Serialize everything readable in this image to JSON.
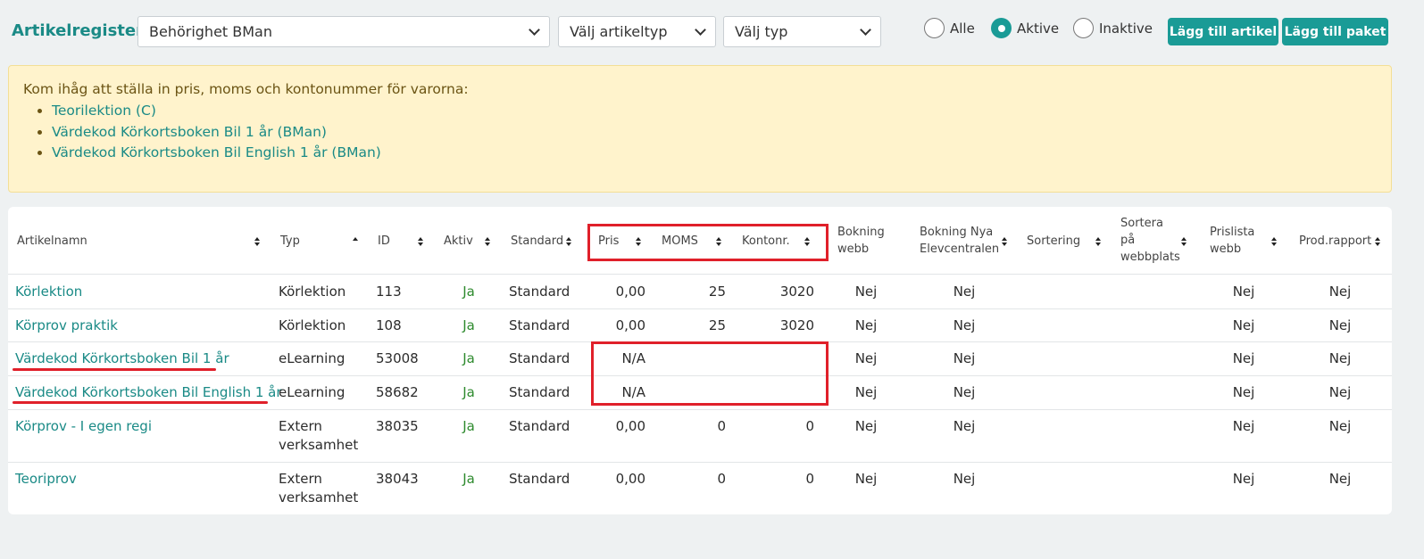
{
  "header": {
    "title": "Artikelregister",
    "behorighet": "Behörighet BMan",
    "artikeltyp": "Välj artikeltyp",
    "typ": "Välj typ",
    "radio_all": "Alle",
    "radio_active": "Aktive",
    "radio_inactive": "Inaktive",
    "btn_add_article": "Lägg till artikel",
    "btn_add_package": "Lägg till paket"
  },
  "alert": {
    "text": "Kom ihåg att ställa in pris, moms och kontonummer för varorna:",
    "items": [
      "Teorilektion (C)",
      "Värdekod Körkortsboken Bil 1 år (BMan)",
      "Värdekod Körkortsboken Bil English 1 år (BMan)"
    ]
  },
  "table": {
    "columns": {
      "artikelnamn": "Artikelnamn",
      "typ": "Typ",
      "id": "ID",
      "aktiv": "Aktiv",
      "standard": "Standard",
      "pris": "Pris",
      "moms": "MOMS",
      "kontonr": "Kontonr.",
      "bokning_webb_1": "Bokning",
      "bokning_webb_2": "webb",
      "bokning_nya_1": "Bokning Nya",
      "bokning_nya_2": "Elevcentralen",
      "sortering": "Sortering",
      "sortera_1": "Sortera",
      "sortera_2": "på",
      "sortera_3": "webbplats",
      "prislista_1": "Prislista",
      "prislista_2": "webb",
      "prodrapport": "Prod.rapport"
    },
    "rows": [
      {
        "name": "Körlektion",
        "typ1": "Körlektion",
        "typ2": "",
        "id": "113",
        "aktiv": "Ja",
        "standard": "Standard",
        "pris": "0,00",
        "moms": "25",
        "konto": "3020",
        "bw": "Nej",
        "bn": "Nej",
        "pw": "Nej",
        "pr": "Nej"
      },
      {
        "name": "Körprov praktik",
        "typ1": "Körlektion",
        "typ2": "",
        "id": "108",
        "aktiv": "Ja",
        "standard": "Standard",
        "pris": "0,00",
        "moms": "25",
        "konto": "3020",
        "bw": "Nej",
        "bn": "Nej",
        "pw": "Nej",
        "pr": "Nej"
      },
      {
        "name": "Värdekod Körkortsboken Bil 1 år",
        "typ1": "eLearning",
        "typ2": "",
        "id": "53008",
        "aktiv": "Ja",
        "standard": "Standard",
        "pris": "N/A",
        "moms": "",
        "konto": "",
        "bw": "Nej",
        "bn": "Nej",
        "pw": "Nej",
        "pr": "Nej"
      },
      {
        "name": "Värdekod Körkortsboken Bil English 1 år",
        "typ1": "eLearning",
        "typ2": "",
        "id": "58682",
        "aktiv": "Ja",
        "standard": "Standard",
        "pris": "N/A",
        "moms": "",
        "konto": "",
        "bw": "Nej",
        "bn": "Nej",
        "pw": "Nej",
        "pr": "Nej"
      },
      {
        "name": "Körprov - I egen regi",
        "typ1": "Extern",
        "typ2": "verksamhet",
        "id": "38035",
        "aktiv": "Ja",
        "standard": "Standard",
        "pris": "0,00",
        "moms": "0",
        "konto": "0",
        "bw": "Nej",
        "bn": "Nej",
        "pw": "Nej",
        "pr": "Nej"
      },
      {
        "name": "Teoriprov",
        "typ1": "Extern",
        "typ2": "verksamhet",
        "id": "38043",
        "aktiv": "Ja",
        "standard": "Standard",
        "pris": "0,00",
        "moms": "0",
        "konto": "0",
        "bw": "Nej",
        "bn": "Nej",
        "pw": "Nej",
        "pr": "Nej"
      }
    ]
  },
  "colors": {
    "accent": "#1a9b96",
    "link": "#1a8a86",
    "highlight": "#e0202a",
    "alert_bg": "#fff3cc"
  }
}
